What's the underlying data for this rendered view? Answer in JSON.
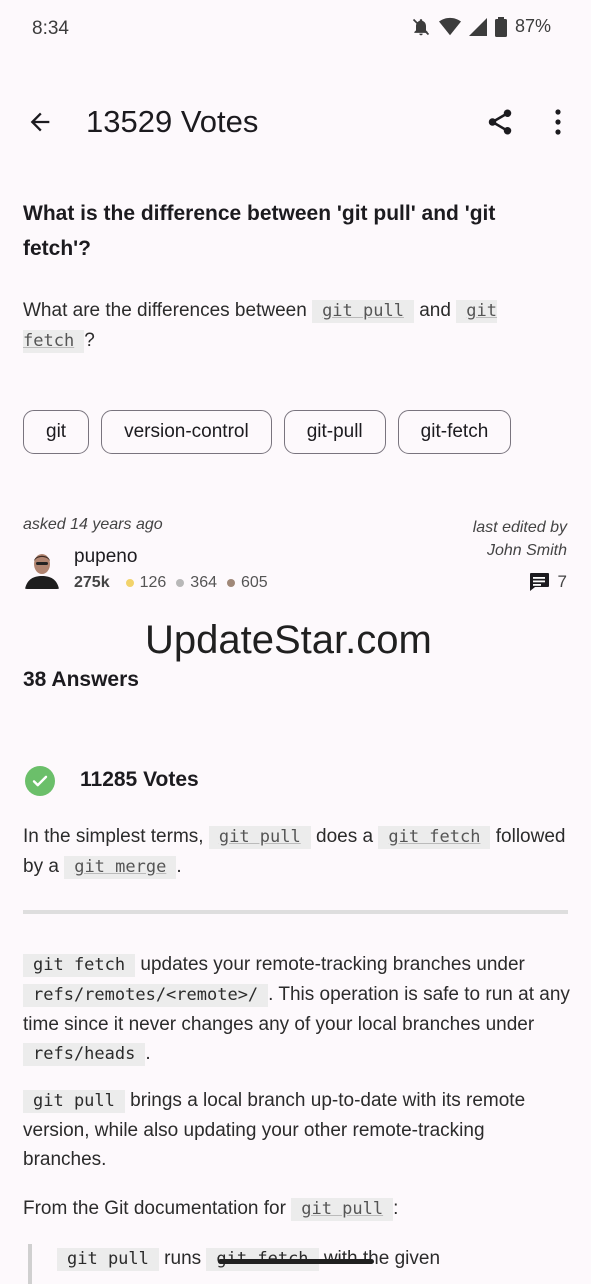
{
  "status": {
    "time": "8:34",
    "battery": "87%",
    "icons": [
      "mute-bell-icon",
      "wifi-icon",
      "signal-icon",
      "battery-icon"
    ]
  },
  "app_bar": {
    "title": "13529 Votes"
  },
  "question": {
    "title": "What is the difference between 'git pull' and 'git fetch'?",
    "body_prefix": "What are the differences between",
    "code1": "git pull",
    "and": "and",
    "code2": "git fetch",
    "suffix": "?",
    "tags": [
      "git",
      "version-control",
      "git-pull",
      "git-fetch"
    ],
    "asked": "asked 14 years ago",
    "edited_label": "last edited by",
    "edited_by": "John Smith",
    "user": {
      "name": "pupeno",
      "reputation": "275k",
      "gold": "126",
      "silver": "364",
      "bronze": "605"
    },
    "comment_count": "7"
  },
  "watermark": "UpdateStar.com",
  "answers_count": "38 Answers",
  "answer": {
    "votes": "11285 Votes",
    "summary": {
      "t1": "In the simplest terms,",
      "c1": "git pull",
      "t2": "does a",
      "c2": "git fetch",
      "t3": "followed by a",
      "c3": "git merge",
      "t4": "."
    },
    "p1": {
      "c1": "git fetch",
      "t1": "updates your remote-tracking branches under",
      "c2": "refs/remotes/<remote>/",
      "t2": ". This operation is safe to run at any time since it never changes any of your local branches under",
      "c3": "refs/heads",
      "t3": "."
    },
    "p2": {
      "c1": "git pull",
      "t1": "brings a local branch up-to-date with its remote version, while also updating your other remote-tracking branches."
    },
    "p3": {
      "t1": "From the Git documentation for",
      "c1": "git pull",
      "t2": ":"
    },
    "quote": {
      "c1": "git pull",
      "t1": "runs",
      "c2": "git fetch",
      "t2": "with the given"
    }
  },
  "colors": {
    "background": "#fdf9fc",
    "accepted": "#6bbf6a",
    "gold": "#f2d36b",
    "silver": "#b8b8b8",
    "bronze": "#a08878"
  }
}
